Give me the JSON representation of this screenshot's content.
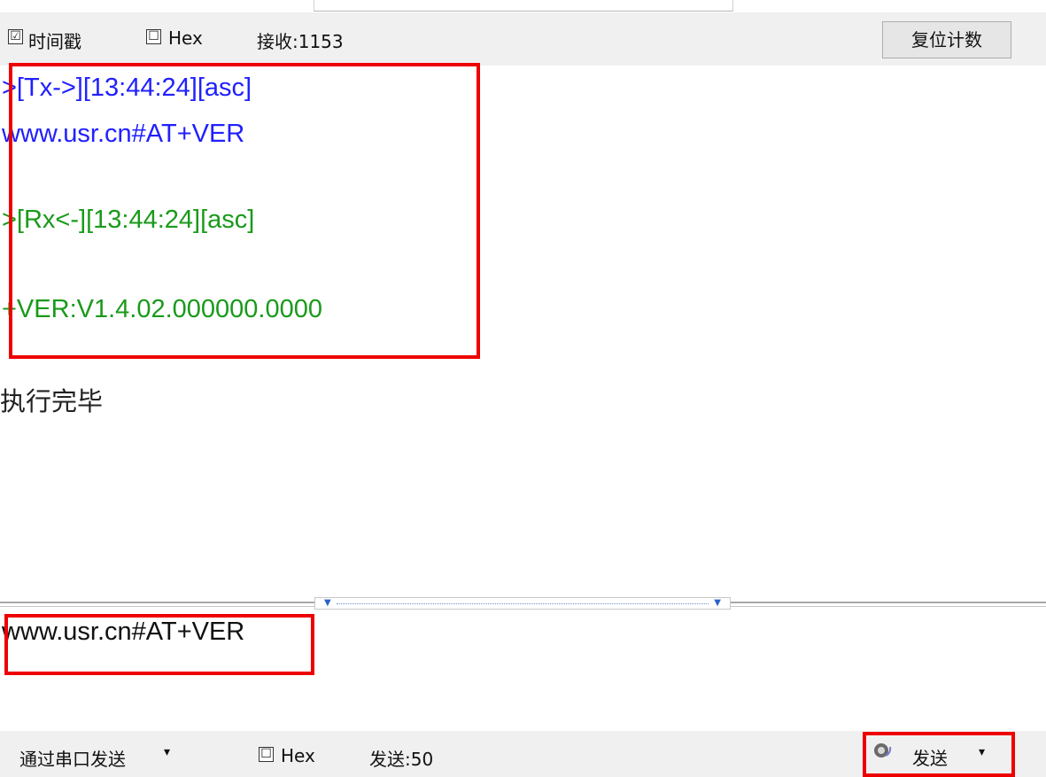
{
  "top_toolbar": {
    "timestamp_checkbox": "☑",
    "timestamp_label": "时间戳",
    "hex_checkbox": "☐",
    "hex_label": "Hex",
    "receive_count": "接收:1153",
    "reset_button": "复位计数"
  },
  "log": {
    "tx_header": ">[Tx->][13:44:24][asc]",
    "tx_body": "www.usr.cn#AT+VER",
    "rx_header": ">[Rx<-][13:44:24][asc]",
    "rx_body": "+VER:V1.4.02.000000.0000",
    "status": "执行完毕"
  },
  "send_area": {
    "input_value": "www.usr.cn#AT+VER"
  },
  "bottom_toolbar": {
    "send_via": "通过串口发送",
    "send_via_arrow": "▾",
    "hex_checkbox": "☐",
    "hex_label": "Hex",
    "send_count": "发送:50",
    "send_button": "发送",
    "send_arrow": "▾"
  },
  "colors": {
    "tx": "#2020ff",
    "rx": "#1a9a1a",
    "highlight": "#ee0000",
    "toolbar_bg": "#f0f0f0"
  },
  "icons": [
    "checkbox-checked-icon",
    "checkbox-unchecked-icon",
    "dropdown-arrow-icon",
    "speaker-icon",
    "splitter-arrow-icon"
  ]
}
